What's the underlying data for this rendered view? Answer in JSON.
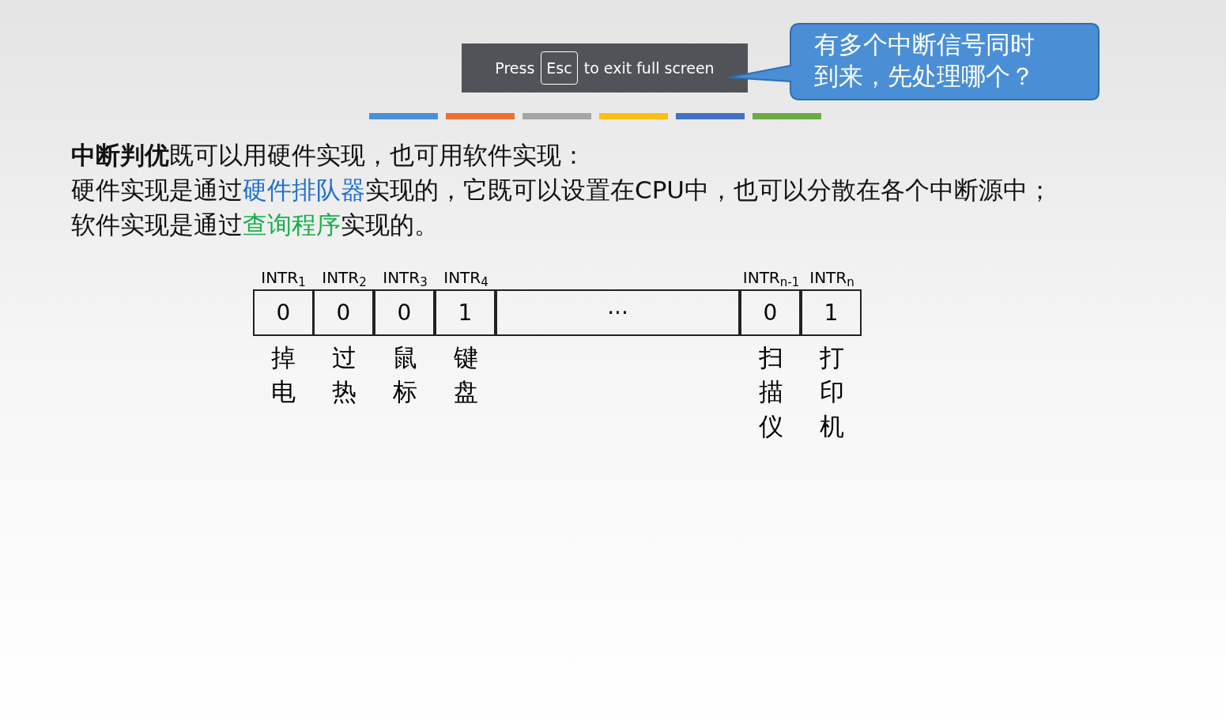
{
  "fullscreen_notice": {
    "before": "Press",
    "key": "Esc",
    "after": "to exit full screen"
  },
  "callout": {
    "lines": [
      "有多个中断信号同时",
      "到来，先处理哪个？"
    ]
  },
  "color_bars": [
    {
      "color": "#4a90d9"
    },
    {
      "color": "#ed7032"
    },
    {
      "color": "#a5a5a5"
    },
    {
      "color": "#fbbf10"
    },
    {
      "color": "#4372c4"
    },
    {
      "color": "#6cab46"
    }
  ],
  "paragraphs": [
    [
      {
        "kind": "bold",
        "text": "中断判优"
      },
      {
        "kind": "plain",
        "text": "既可以用硬件实现，也可用软件实现："
      }
    ],
    [
      {
        "kind": "plain",
        "text": "硬件实现是通过"
      },
      {
        "kind": "blue",
        "text": "硬件排队器"
      },
      {
        "kind": "plain",
        "text": "实现的，它既可以设置在CPU中，也可以分散在各个中断源中；"
      }
    ],
    [
      {
        "kind": "plain",
        "text": "软件实现是通过"
      },
      {
        "kind": "green",
        "text": "查询程序"
      },
      {
        "kind": "plain",
        "text": "实现的。"
      }
    ]
  ],
  "register": [
    {
      "kind": "bit",
      "label": "INTR$_{1}$",
      "value": "0",
      "device": "掉电"
    },
    {
      "kind": "bit",
      "label": "INTR$_{2}$",
      "value": "0",
      "device": "过热"
    },
    {
      "kind": "bit",
      "label": "INTR$_{3}$",
      "value": "0",
      "device": "鼠标"
    },
    {
      "kind": "bit",
      "label": "INTR$_{4}$",
      "value": "1",
      "device": "键盘"
    },
    {
      "kind": "gap",
      "value": "···"
    },
    {
      "kind": "bit",
      "label": "INTR$_{n-1}$",
      "value": "0",
      "device": "扫描仪"
    },
    {
      "kind": "bit",
      "label": "INTR$_{n}$",
      "value": "1",
      "device": "打印机"
    }
  ]
}
